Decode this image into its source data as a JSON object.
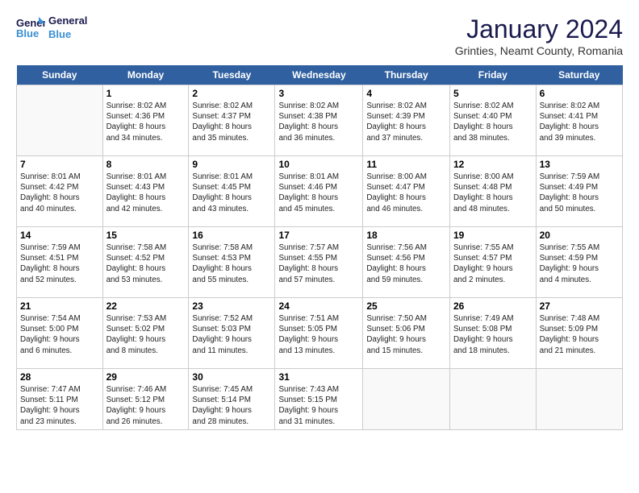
{
  "header": {
    "logo_line1": "General",
    "logo_line2": "Blue",
    "title": "January 2024",
    "subtitle": "Grinties, Neamt County, Romania"
  },
  "days": [
    "Sunday",
    "Monday",
    "Tuesday",
    "Wednesday",
    "Thursday",
    "Friday",
    "Saturday"
  ],
  "weeks": [
    [
      {
        "date": "",
        "content": ""
      },
      {
        "date": "1",
        "content": "Sunrise: 8:02 AM\nSunset: 4:36 PM\nDaylight: 8 hours\nand 34 minutes."
      },
      {
        "date": "2",
        "content": "Sunrise: 8:02 AM\nSunset: 4:37 PM\nDaylight: 8 hours\nand 35 minutes."
      },
      {
        "date": "3",
        "content": "Sunrise: 8:02 AM\nSunset: 4:38 PM\nDaylight: 8 hours\nand 36 minutes."
      },
      {
        "date": "4",
        "content": "Sunrise: 8:02 AM\nSunset: 4:39 PM\nDaylight: 8 hours\nand 37 minutes."
      },
      {
        "date": "5",
        "content": "Sunrise: 8:02 AM\nSunset: 4:40 PM\nDaylight: 8 hours\nand 38 minutes."
      },
      {
        "date": "6",
        "content": "Sunrise: 8:02 AM\nSunset: 4:41 PM\nDaylight: 8 hours\nand 39 minutes."
      }
    ],
    [
      {
        "date": "7",
        "content": "Sunrise: 8:01 AM\nSunset: 4:42 PM\nDaylight: 8 hours\nand 40 minutes."
      },
      {
        "date": "8",
        "content": "Sunrise: 8:01 AM\nSunset: 4:43 PM\nDaylight: 8 hours\nand 42 minutes."
      },
      {
        "date": "9",
        "content": "Sunrise: 8:01 AM\nSunset: 4:45 PM\nDaylight: 8 hours\nand 43 minutes."
      },
      {
        "date": "10",
        "content": "Sunrise: 8:01 AM\nSunset: 4:46 PM\nDaylight: 8 hours\nand 45 minutes."
      },
      {
        "date": "11",
        "content": "Sunrise: 8:00 AM\nSunset: 4:47 PM\nDaylight: 8 hours\nand 46 minutes."
      },
      {
        "date": "12",
        "content": "Sunrise: 8:00 AM\nSunset: 4:48 PM\nDaylight: 8 hours\nand 48 minutes."
      },
      {
        "date": "13",
        "content": "Sunrise: 7:59 AM\nSunset: 4:49 PM\nDaylight: 8 hours\nand 50 minutes."
      }
    ],
    [
      {
        "date": "14",
        "content": "Sunrise: 7:59 AM\nSunset: 4:51 PM\nDaylight: 8 hours\nand 52 minutes."
      },
      {
        "date": "15",
        "content": "Sunrise: 7:58 AM\nSunset: 4:52 PM\nDaylight: 8 hours\nand 53 minutes."
      },
      {
        "date": "16",
        "content": "Sunrise: 7:58 AM\nSunset: 4:53 PM\nDaylight: 8 hours\nand 55 minutes."
      },
      {
        "date": "17",
        "content": "Sunrise: 7:57 AM\nSunset: 4:55 PM\nDaylight: 8 hours\nand 57 minutes."
      },
      {
        "date": "18",
        "content": "Sunrise: 7:56 AM\nSunset: 4:56 PM\nDaylight: 8 hours\nand 59 minutes."
      },
      {
        "date": "19",
        "content": "Sunrise: 7:55 AM\nSunset: 4:57 PM\nDaylight: 9 hours\nand 2 minutes."
      },
      {
        "date": "20",
        "content": "Sunrise: 7:55 AM\nSunset: 4:59 PM\nDaylight: 9 hours\nand 4 minutes."
      }
    ],
    [
      {
        "date": "21",
        "content": "Sunrise: 7:54 AM\nSunset: 5:00 PM\nDaylight: 9 hours\nand 6 minutes."
      },
      {
        "date": "22",
        "content": "Sunrise: 7:53 AM\nSunset: 5:02 PM\nDaylight: 9 hours\nand 8 minutes."
      },
      {
        "date": "23",
        "content": "Sunrise: 7:52 AM\nSunset: 5:03 PM\nDaylight: 9 hours\nand 11 minutes."
      },
      {
        "date": "24",
        "content": "Sunrise: 7:51 AM\nSunset: 5:05 PM\nDaylight: 9 hours\nand 13 minutes."
      },
      {
        "date": "25",
        "content": "Sunrise: 7:50 AM\nSunset: 5:06 PM\nDaylight: 9 hours\nand 15 minutes."
      },
      {
        "date": "26",
        "content": "Sunrise: 7:49 AM\nSunset: 5:08 PM\nDaylight: 9 hours\nand 18 minutes."
      },
      {
        "date": "27",
        "content": "Sunrise: 7:48 AM\nSunset: 5:09 PM\nDaylight: 9 hours\nand 21 minutes."
      }
    ],
    [
      {
        "date": "28",
        "content": "Sunrise: 7:47 AM\nSunset: 5:11 PM\nDaylight: 9 hours\nand 23 minutes."
      },
      {
        "date": "29",
        "content": "Sunrise: 7:46 AM\nSunset: 5:12 PM\nDaylight: 9 hours\nand 26 minutes."
      },
      {
        "date": "30",
        "content": "Sunrise: 7:45 AM\nSunset: 5:14 PM\nDaylight: 9 hours\nand 28 minutes."
      },
      {
        "date": "31",
        "content": "Sunrise: 7:43 AM\nSunset: 5:15 PM\nDaylight: 9 hours\nand 31 minutes."
      },
      {
        "date": "",
        "content": ""
      },
      {
        "date": "",
        "content": ""
      },
      {
        "date": "",
        "content": ""
      }
    ]
  ]
}
